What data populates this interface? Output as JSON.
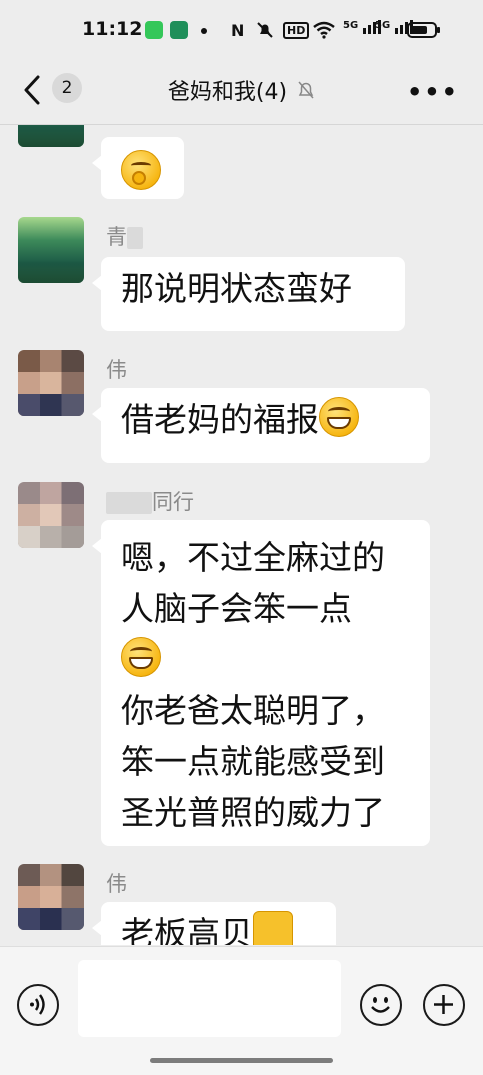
{
  "status_bar": {
    "time": "11:12",
    "nfc": "N",
    "hd": "HD",
    "sim1": "5G",
    "sim2": "5G",
    "icons": [
      "messages-app-icon",
      "oppo-app-icon",
      "nfc-icon",
      "mute-icon",
      "hd-icon",
      "wifi-icon",
      "signal-icon",
      "signal-icon",
      "battery-icon"
    ]
  },
  "header": {
    "unread_count": "2",
    "title": "爸妈和我(4)",
    "icons": [
      "back-arrow-icon",
      "mute-bell-icon",
      "more-dots-icon"
    ]
  },
  "messages": [
    {
      "sender": "",
      "avatar": "forest",
      "lines": [],
      "emoji": "pinch-emoji"
    },
    {
      "sender": "青",
      "avatar": "forest",
      "lines": [
        "那说明状态蛮好"
      ]
    },
    {
      "sender": "伟",
      "avatar": "pixelated-person",
      "lines": [
        "借老妈的福报"
      ],
      "emoji": "grin-emoji"
    },
    {
      "sender": "同行",
      "avatar": "pixelated-person",
      "lines": [
        "嗯，不过全麻过的",
        "人脑子会笨一点",
        "你老爸太聪明了，",
        "笨一点就能感受到",
        "圣光普照的威力了"
      ],
      "emoji": "grin-emoji"
    },
    {
      "sender": "伟",
      "avatar": "pixelated-person",
      "lines": [
        "老板高贝"
      ],
      "emoji": "thumbs-up-emoji"
    }
  ],
  "input_bar": {
    "icons": [
      "voice-icon",
      "emoji-icon",
      "plus-icon"
    ]
  },
  "colors": {
    "chat_background": "#ededed",
    "bubble": "#ffffff",
    "sender_name": "#8a8a8a"
  }
}
